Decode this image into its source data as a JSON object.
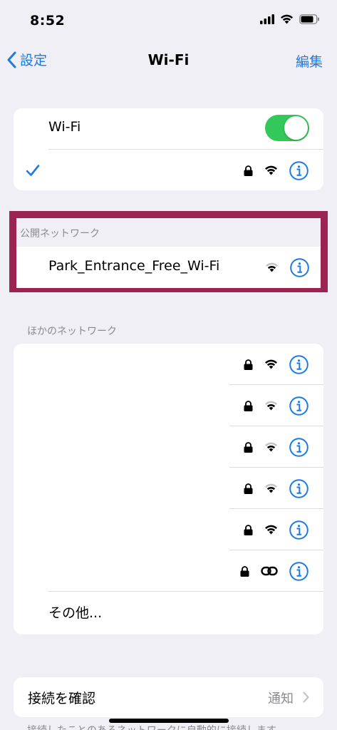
{
  "status": {
    "time": "8:52"
  },
  "nav": {
    "back_label": "設定",
    "title": "Wi-Fi",
    "edit_label": "編集"
  },
  "wifi": {
    "toggle_label": "Wi-Fi",
    "enabled": true,
    "connected_name": ""
  },
  "public": {
    "header": "公開ネットワーク",
    "networks": [
      {
        "name": "Park_Entrance_Free_Wi-Fi",
        "secured": false
      }
    ]
  },
  "other": {
    "header": "ほかのネットワーク",
    "networks": [
      {
        "name": "",
        "secured": true,
        "icon": "wifi-icon"
      },
      {
        "name": "",
        "secured": true,
        "icon": "wifi-icon"
      },
      {
        "name": "",
        "secured": true,
        "icon": "wifi-icon"
      },
      {
        "name": "",
        "secured": true,
        "icon": "wifi-icon"
      },
      {
        "name": "",
        "secured": true,
        "icon": "wifi-icon"
      },
      {
        "name": "",
        "secured": true,
        "icon": "link-icon"
      }
    ],
    "other_label": "その他..."
  },
  "confirm": {
    "label": "接続を確認",
    "value": "通知"
  },
  "footer_note": "接続したことのあるネットワークに自動的に接続します",
  "colors": {
    "accent": "#1f7ae0",
    "toggle_on": "#34c759",
    "highlight": "#9b2450"
  }
}
